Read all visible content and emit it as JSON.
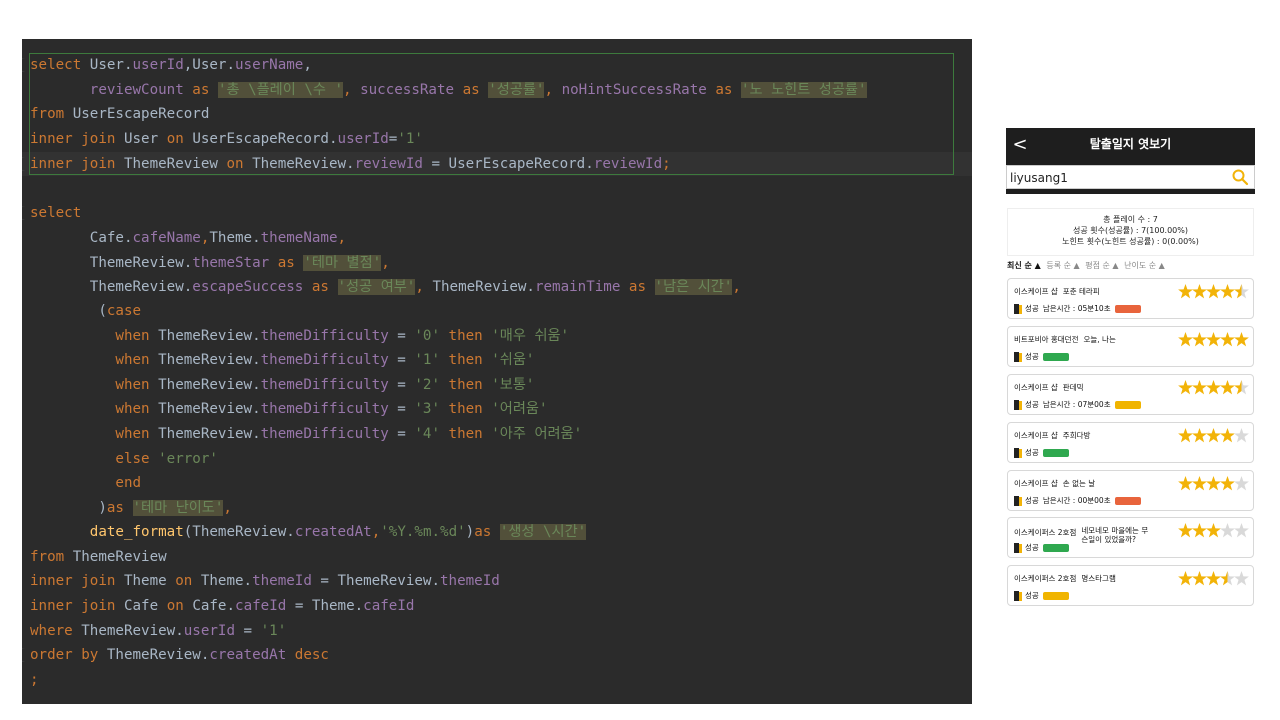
{
  "editor": {
    "lines": [
      {
        "t": 14,
        "tokens": [
          [
            "kw",
            "select "
          ],
          [
            "",
            "User."
          ],
          [
            "fld",
            "userId"
          ],
          [
            "",
            ",User."
          ],
          [
            "fld",
            "userName"
          ],
          [
            "",
            ","
          ]
        ]
      },
      {
        "t": 39,
        "tokens": [
          [
            "",
            "       "
          ],
          [
            "fld",
            "reviewCount"
          ],
          [
            "kw",
            " as "
          ],
          [
            "hlstr",
            "'총 \\플레이 \\수 '"
          ],
          [
            "kw",
            ", "
          ],
          [
            "fld",
            "successRate"
          ],
          [
            "kw",
            " as "
          ],
          [
            "hlstr",
            "'성공률'"
          ],
          [
            "kw",
            ", "
          ],
          [
            "fld",
            "noHintSuccessRate"
          ],
          [
            "kw",
            " as "
          ],
          [
            "hlstr",
            "'노 노힌트 성공률'"
          ]
        ]
      },
      {
        "t": 63,
        "tokens": [
          [
            "kw",
            "from "
          ],
          [
            "",
            "UserEscapeRecord"
          ]
        ]
      },
      {
        "t": 88,
        "tokens": [
          [
            "kw",
            "inner join "
          ],
          [
            "",
            "User "
          ],
          [
            "kw",
            "on "
          ],
          [
            "",
            "UserEscapeRecord."
          ],
          [
            "fld",
            "userId"
          ],
          [
            "",
            "="
          ],
          [
            "str",
            "'1'"
          ]
        ]
      },
      {
        "t": 113,
        "tokens": [
          [
            "kw",
            "inner join "
          ],
          [
            "",
            "ThemeReview "
          ],
          [
            "kw",
            "on "
          ],
          [
            "",
            "ThemeReview."
          ],
          [
            "fld",
            "reviewId"
          ],
          [
            "",
            " = UserEscapeRecord."
          ],
          [
            "fld",
            "reviewId"
          ],
          [
            "kw",
            ";"
          ]
        ]
      },
      {
        "t": 162,
        "tokens": [
          [
            "kw",
            "select"
          ]
        ]
      },
      {
        "t": 187,
        "tokens": [
          [
            "",
            "       Cafe."
          ],
          [
            "fld",
            "cafeName"
          ],
          [
            "kw",
            ","
          ],
          [
            "",
            "Theme."
          ],
          [
            "fld",
            "themeName"
          ],
          [
            "kw",
            ","
          ]
        ]
      },
      {
        "t": 212,
        "tokens": [
          [
            "",
            "       ThemeReview."
          ],
          [
            "fld",
            "themeStar"
          ],
          [
            "kw",
            " as "
          ],
          [
            "hlstr",
            "'테마 별점'"
          ],
          [
            "kw",
            ","
          ]
        ]
      },
      {
        "t": 236,
        "tokens": [
          [
            "",
            "       ThemeReview."
          ],
          [
            "fld",
            "escapeSuccess"
          ],
          [
            "kw",
            " as "
          ],
          [
            "hlstr",
            "'성공 여부'"
          ],
          [
            "kw",
            ", "
          ],
          [
            "",
            "ThemeReview."
          ],
          [
            "fld",
            "remainTime"
          ],
          [
            "kw",
            " as "
          ],
          [
            "hlstr",
            "'남은 시간'"
          ],
          [
            "kw",
            ","
          ]
        ]
      },
      {
        "t": 260,
        "tokens": [
          [
            "",
            "        ("
          ],
          [
            "kw",
            "case"
          ]
        ]
      },
      {
        "t": 285,
        "tokens": [
          [
            "",
            "          "
          ],
          [
            "kw",
            "when "
          ],
          [
            "",
            "ThemeReview."
          ],
          [
            "fld",
            "themeDifficulty"
          ],
          [
            "",
            " = "
          ],
          [
            "str",
            "'0'"
          ],
          [
            "kw",
            " then "
          ],
          [
            "str",
            "'매우 쉬움'"
          ]
        ]
      },
      {
        "t": 309,
        "tokens": [
          [
            "",
            "          "
          ],
          [
            "kw",
            "when "
          ],
          [
            "",
            "ThemeReview."
          ],
          [
            "fld",
            "themeDifficulty"
          ],
          [
            "",
            " = "
          ],
          [
            "str",
            "'1'"
          ],
          [
            "kw",
            " then "
          ],
          [
            "str",
            "'쉬움'"
          ]
        ]
      },
      {
        "t": 334,
        "tokens": [
          [
            "",
            "          "
          ],
          [
            "kw",
            "when "
          ],
          [
            "",
            "ThemeReview."
          ],
          [
            "fld",
            "themeDifficulty"
          ],
          [
            "",
            " = "
          ],
          [
            "str",
            "'2'"
          ],
          [
            "kw",
            " then "
          ],
          [
            "str",
            "'보통'"
          ]
        ]
      },
      {
        "t": 358,
        "tokens": [
          [
            "",
            "          "
          ],
          [
            "kw",
            "when "
          ],
          [
            "",
            "ThemeReview."
          ],
          [
            "fld",
            "themeDifficulty"
          ],
          [
            "",
            " = "
          ],
          [
            "str",
            "'3'"
          ],
          [
            "kw",
            " then "
          ],
          [
            "str",
            "'어려움'"
          ]
        ]
      },
      {
        "t": 383,
        "tokens": [
          [
            "",
            "          "
          ],
          [
            "kw",
            "when "
          ],
          [
            "",
            "ThemeReview."
          ],
          [
            "fld",
            "themeDifficulty"
          ],
          [
            "",
            " = "
          ],
          [
            "str",
            "'4'"
          ],
          [
            "kw",
            " then "
          ],
          [
            "str",
            "'아주 어려움'"
          ]
        ]
      },
      {
        "t": 408,
        "tokens": [
          [
            "",
            "          "
          ],
          [
            "kw",
            "else "
          ],
          [
            "str",
            "'error'"
          ]
        ]
      },
      {
        "t": 432,
        "tokens": [
          [
            "",
            "          "
          ],
          [
            "kw",
            "end"
          ]
        ]
      },
      {
        "t": 457,
        "tokens": [
          [
            "",
            "        )"
          ],
          [
            "kw",
            "as "
          ],
          [
            "hlstr",
            "'테마 난이도'"
          ],
          [
            "kw",
            ","
          ]
        ]
      },
      {
        "t": 481,
        "tokens": [
          [
            "",
            "       "
          ],
          [
            "fn",
            "date_format"
          ],
          [
            "",
            "(ThemeReview."
          ],
          [
            "fld",
            "createdAt"
          ],
          [
            "kw",
            ","
          ],
          [
            "str",
            "'%Y.%m.%d'"
          ],
          [
            "",
            ")"
          ],
          [
            "kw",
            "as "
          ],
          [
            "hlstr",
            "'생성 \\시간'"
          ]
        ]
      },
      {
        "t": 506,
        "tokens": [
          [
            "kw",
            "from "
          ],
          [
            "",
            "ThemeReview"
          ]
        ]
      },
      {
        "t": 530,
        "tokens": [
          [
            "kw",
            "inner join "
          ],
          [
            "",
            "Theme "
          ],
          [
            "kw",
            "on "
          ],
          [
            "",
            "Theme."
          ],
          [
            "fld",
            "themeId"
          ],
          [
            "",
            " = ThemeReview."
          ],
          [
            "fld",
            "themeId"
          ]
        ]
      },
      {
        "t": 555,
        "tokens": [
          [
            "kw",
            "inner join "
          ],
          [
            "",
            "Cafe "
          ],
          [
            "kw",
            "on "
          ],
          [
            "",
            "Cafe."
          ],
          [
            "fld",
            "cafeId"
          ],
          [
            "",
            " = Theme."
          ],
          [
            "fld",
            "cafeId"
          ]
        ]
      },
      {
        "t": 580,
        "tokens": [
          [
            "kw",
            "where "
          ],
          [
            "",
            "ThemeReview."
          ],
          [
            "fld",
            "userId"
          ],
          [
            "",
            " = "
          ],
          [
            "str",
            "'1'"
          ]
        ]
      },
      {
        "t": 604,
        "tokens": [
          [
            "kw",
            "order by "
          ],
          [
            "",
            "ThemeReview."
          ],
          [
            "fld",
            "createdAt"
          ],
          [
            "kw",
            " desc"
          ]
        ]
      },
      {
        "t": 629,
        "tokens": [
          [
            "kw",
            ";"
          ]
        ]
      }
    ],
    "gutter_marks": [
      14,
      113,
      162,
      604
    ]
  },
  "phone": {
    "back_glyph": "<",
    "title": "탈출일지 엿보기",
    "search_value": "liyusang1",
    "summary": {
      "line1": "총 플레이 수 : 7",
      "line2": "성공 횟수(성공률) : 7(100.00%)",
      "line3": "노힌트 횟수(노힌트 성공률) : 0(0.00%)"
    },
    "sort": [
      "최신 순 ▲",
      "등록 순 ▲",
      "평점 순 ▲",
      "난이도 순 ▲"
    ],
    "cards": [
      {
        "cafe": "이스케이프 샵",
        "theme": "포춘 테라피",
        "result": "성공",
        "remain": "남은시간 : 05분10초",
        "badge_color": "#e8643c",
        "rating": 4.5
      },
      {
        "cafe": "비트포비아 홍대던전",
        "theme": "오늘, 나는",
        "result": "성공",
        "remain": "",
        "badge_color": "#2fa84f",
        "rating": 5
      },
      {
        "cafe": "이스케이프 샵",
        "theme": "판데믹",
        "result": "성공",
        "remain": "남은시간 : 07분00초",
        "badge_color": "#f0b400",
        "rating": 4.5
      },
      {
        "cafe": "이스케이프 샵",
        "theme": "주희다방",
        "result": "성공",
        "remain": "",
        "badge_color": "#2fa84f",
        "rating": 4
      },
      {
        "cafe": "이스케이프 샵",
        "theme": "손 없는 날",
        "result": "성공",
        "remain": "남은시간 : 00분00초",
        "badge_color": "#e8643c",
        "rating": 4
      },
      {
        "cafe": "이스케이퍼스 2호점",
        "theme": "네모네모 마을에는 무슨일이 있었을까?",
        "result": "성공",
        "remain": "",
        "badge_color": "#2fa84f",
        "rating": 3
      },
      {
        "cafe": "이스케이퍼스 2호점",
        "theme": "명스타그램",
        "result": "성공",
        "remain": "",
        "badge_color": "#f0b400",
        "rating": 3.5
      }
    ],
    "colors": {
      "star": "#f2b308",
      "star_empty": "#d9d9d9",
      "header": "#1e1e1e",
      "search_icon": "#f2b308"
    }
  }
}
